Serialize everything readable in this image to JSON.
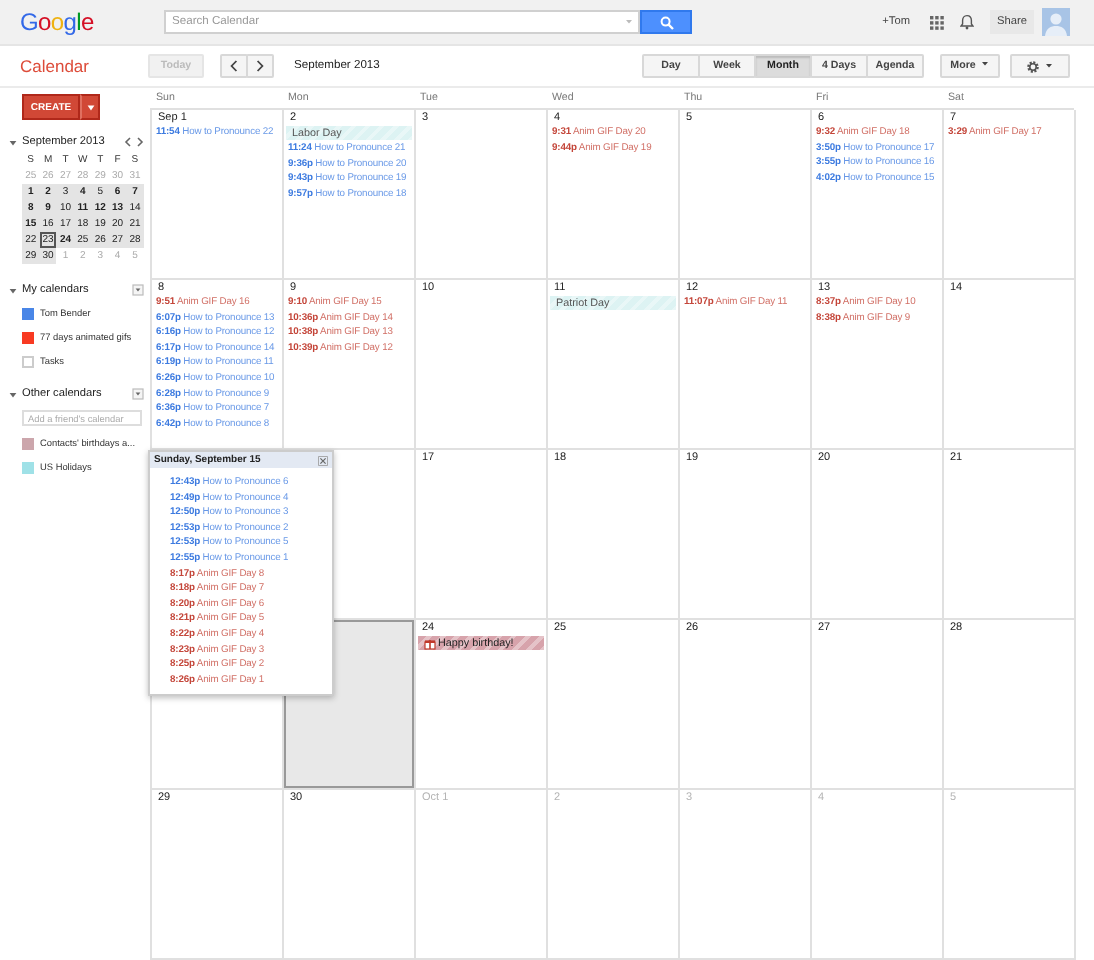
{
  "header": {
    "logo": "Google",
    "search": {
      "placeholder": "Search Calendar"
    },
    "user": "+Tom",
    "share": "Share"
  },
  "toolbar": {
    "app_title": "Calendar",
    "today": {
      "label": "Today",
      "disabled": true
    },
    "period": "September 2013",
    "views": [
      {
        "label": "Day",
        "selected": false
      },
      {
        "label": "Week",
        "selected": false
      },
      {
        "label": "Month",
        "selected": true
      },
      {
        "label": "4 Days",
        "selected": false
      },
      {
        "label": "Agenda",
        "selected": false
      }
    ],
    "more": "More"
  },
  "sidebar": {
    "create": "CREATE",
    "mini_calendar": {
      "title": "September 2013",
      "expanded": true,
      "weekdays": [
        "S",
        "M",
        "T",
        "W",
        "T",
        "F",
        "S"
      ],
      "weeks": [
        [
          {
            "day": "25",
            "in_month": false,
            "bold": false,
            "today": false
          },
          {
            "day": "26",
            "in_month": false,
            "bold": false,
            "today": false
          },
          {
            "day": "27",
            "in_month": false,
            "bold": false,
            "today": false
          },
          {
            "day": "28",
            "in_month": false,
            "bold": false,
            "today": false
          },
          {
            "day": "29",
            "in_month": false,
            "bold": false,
            "today": false
          },
          {
            "day": "30",
            "in_month": false,
            "bold": false,
            "today": false
          },
          {
            "day": "31",
            "in_month": false,
            "bold": false,
            "today": false
          }
        ],
        [
          {
            "day": "1",
            "in_month": true,
            "bold": true,
            "today": false
          },
          {
            "day": "2",
            "in_month": true,
            "bold": true,
            "today": false
          },
          {
            "day": "3",
            "in_month": true,
            "bold": false,
            "today": false
          },
          {
            "day": "4",
            "in_month": true,
            "bold": true,
            "today": false
          },
          {
            "day": "5",
            "in_month": true,
            "bold": false,
            "today": false
          },
          {
            "day": "6",
            "in_month": true,
            "bold": true,
            "today": false
          },
          {
            "day": "7",
            "in_month": true,
            "bold": true,
            "today": false
          }
        ],
        [
          {
            "day": "8",
            "in_month": true,
            "bold": true,
            "today": false
          },
          {
            "day": "9",
            "in_month": true,
            "bold": true,
            "today": false
          },
          {
            "day": "10",
            "in_month": true,
            "bold": false,
            "today": false
          },
          {
            "day": "11",
            "in_month": true,
            "bold": true,
            "today": false
          },
          {
            "day": "12",
            "in_month": true,
            "bold": true,
            "today": false
          },
          {
            "day": "13",
            "in_month": true,
            "bold": true,
            "today": false
          },
          {
            "day": "14",
            "in_month": true,
            "bold": false,
            "today": false
          }
        ],
        [
          {
            "day": "15",
            "in_month": true,
            "bold": true,
            "today": false
          },
          {
            "day": "16",
            "in_month": true,
            "bold": false,
            "today": false
          },
          {
            "day": "17",
            "in_month": true,
            "bold": false,
            "today": false
          },
          {
            "day": "18",
            "in_month": true,
            "bold": false,
            "today": false
          },
          {
            "day": "19",
            "in_month": true,
            "bold": false,
            "today": false
          },
          {
            "day": "20",
            "in_month": true,
            "bold": false,
            "today": false
          },
          {
            "day": "21",
            "in_month": true,
            "bold": false,
            "today": false
          }
        ],
        [
          {
            "day": "22",
            "in_month": true,
            "bold": false,
            "today": false
          },
          {
            "day": "23",
            "in_month": true,
            "bold": false,
            "today": true
          },
          {
            "day": "24",
            "in_month": true,
            "bold": true,
            "today": false
          },
          {
            "day": "25",
            "in_month": true,
            "bold": false,
            "today": false
          },
          {
            "day": "26",
            "in_month": true,
            "bold": false,
            "today": false
          },
          {
            "day": "27",
            "in_month": true,
            "bold": false,
            "today": false
          },
          {
            "day": "28",
            "in_month": true,
            "bold": false,
            "today": false
          }
        ],
        [
          {
            "day": "29",
            "in_month": true,
            "bold": false,
            "today": false
          },
          {
            "day": "30",
            "in_month": true,
            "bold": false,
            "today": false
          },
          {
            "day": "1",
            "in_month": false,
            "bold": false,
            "today": false
          },
          {
            "day": "2",
            "in_month": false,
            "bold": false,
            "today": false
          },
          {
            "day": "3",
            "in_month": false,
            "bold": false,
            "today": false
          },
          {
            "day": "4",
            "in_month": false,
            "bold": false,
            "today": false
          },
          {
            "day": "5",
            "in_month": false,
            "bold": false,
            "today": false
          }
        ]
      ]
    },
    "my_calendars": {
      "title": "My calendars",
      "expanded": true,
      "items": [
        {
          "name": "Tom Bender",
          "checked": true,
          "color": "#4986e7"
        },
        {
          "name": "77 days animated gifs",
          "checked": true,
          "color": "#f83a22"
        },
        {
          "name": "Tasks",
          "checked": false
        }
      ]
    },
    "other_calendars": {
      "title": "Other calendars",
      "expanded": true,
      "add_placeholder": "Add a friend's calendar",
      "items": [
        {
          "name": "Contacts' birthdays a...",
          "checked": true,
          "color": "#cca6ac"
        },
        {
          "name": "US Holidays",
          "checked": true,
          "color": "#9fe1e7"
        }
      ]
    }
  },
  "month": {
    "weekdays": [
      "Sun",
      "Mon",
      "Tue",
      "Wed",
      "Thu",
      "Fri",
      "Sat"
    ],
    "weeks": [
      {
        "days": [
          {
            "label": "Sep 1",
            "in_month": true,
            "today": false,
            "events": [
              {
                "kind": "timed",
                "time": "11:54",
                "title": "How to Pronounce 22",
                "color": "#3d7be0"
              }
            ]
          },
          {
            "label": "2",
            "in_month": true,
            "today": false,
            "events": [
              {
                "kind": "holiday",
                "title": "Labor Day",
                "color": "#ddf3f3"
              },
              {
                "kind": "timed",
                "time": "11:24",
                "title": "How to Pronounce 21",
                "color": "#3d7be0"
              },
              {
                "kind": "timed",
                "time": "9:36p",
                "title": "How to Pronounce 20",
                "color": "#3d7be0"
              },
              {
                "kind": "timed",
                "time": "9:43p",
                "title": "How to Pronounce 19",
                "color": "#3d7be0"
              },
              {
                "kind": "timed",
                "time": "9:57p",
                "title": "How to Pronounce 18",
                "color": "#3d7be0"
              }
            ]
          },
          {
            "label": "3",
            "in_month": true,
            "today": false
          },
          {
            "label": "4",
            "in_month": true,
            "today": false,
            "events": [
              {
                "kind": "timed",
                "time": "9:31",
                "title": "Anim GIF Day 20",
                "color": "#c4463a"
              },
              {
                "kind": "timed",
                "time": "9:44p",
                "title": "Anim GIF Day 19",
                "color": "#c4463a"
              }
            ]
          },
          {
            "label": "5",
            "in_month": true,
            "today": false
          },
          {
            "label": "6",
            "in_month": true,
            "today": false,
            "events": [
              {
                "kind": "timed",
                "time": "9:32",
                "title": "Anim GIF Day 18",
                "color": "#c4463a"
              },
              {
                "kind": "timed",
                "time": "3:50p",
                "title": "How to Pronounce 17",
                "color": "#3d7be0"
              },
              {
                "kind": "timed",
                "time": "3:55p",
                "title": "How to Pronounce 16",
                "color": "#3d7be0"
              },
              {
                "kind": "timed",
                "time": "4:02p",
                "title": "How to Pronounce 15",
                "color": "#3d7be0"
              }
            ]
          },
          {
            "label": "7",
            "in_month": true,
            "today": false,
            "events": [
              {
                "kind": "timed",
                "time": "3:29",
                "title": "Anim GIF Day 17",
                "color": "#c4463a"
              }
            ]
          }
        ]
      },
      {
        "days": [
          {
            "label": "8",
            "in_month": true,
            "today": false,
            "events": [
              {
                "kind": "timed",
                "time": "9:51",
                "title": "Anim GIF Day 16",
                "color": "#c4463a"
              },
              {
                "kind": "timed",
                "time": "6:07p",
                "title": "How to Pronounce 13",
                "color": "#3d7be0"
              },
              {
                "kind": "timed",
                "time": "6:16p",
                "title": "How to Pronounce 12",
                "color": "#3d7be0"
              },
              {
                "kind": "timed",
                "time": "6:17p",
                "title": "How to Pronounce 14",
                "color": "#3d7be0"
              },
              {
                "kind": "timed",
                "time": "6:19p",
                "title": "How to Pronounce 11",
                "color": "#3d7be0"
              },
              {
                "kind": "timed",
                "time": "6:26p",
                "title": "How to Pronounce 10",
                "color": "#3d7be0"
              },
              {
                "kind": "timed",
                "time": "6:28p",
                "title": "How to Pronounce 9",
                "color": "#3d7be0"
              },
              {
                "kind": "timed",
                "time": "6:36p",
                "title": "How to Pronounce 7",
                "color": "#3d7be0"
              },
              {
                "kind": "timed",
                "time": "6:42p",
                "title": "How to Pronounce 8",
                "color": "#3d7be0"
              }
            ]
          },
          {
            "label": "9",
            "in_month": true,
            "today": false,
            "events": [
              {
                "kind": "timed",
                "time": "9:10",
                "title": "Anim GIF Day 15",
                "color": "#c4463a"
              },
              {
                "kind": "timed",
                "time": "10:36p",
                "title": "Anim GIF Day 14",
                "color": "#c4463a"
              },
              {
                "kind": "timed",
                "time": "10:38p",
                "title": "Anim GIF Day 13",
                "color": "#c4463a"
              },
              {
                "kind": "timed",
                "time": "10:39p",
                "title": "Anim GIF Day 12",
                "color": "#c4463a"
              }
            ]
          },
          {
            "label": "10",
            "in_month": true,
            "today": false
          },
          {
            "label": "11",
            "in_month": true,
            "today": false,
            "events": [
              {
                "kind": "holiday",
                "title": "Patriot Day",
                "color": "#ddf3f3"
              }
            ]
          },
          {
            "label": "12",
            "in_month": true,
            "today": false,
            "events": [
              {
                "kind": "timed",
                "time": "11:07p",
                "title": "Anim GIF Day 11",
                "color": "#c4463a"
              }
            ]
          },
          {
            "label": "13",
            "in_month": true,
            "today": false,
            "events": [
              {
                "kind": "timed",
                "time": "8:37p",
                "title": "Anim GIF Day 10",
                "color": "#c4463a"
              },
              {
                "kind": "timed",
                "time": "8:38p",
                "title": "Anim GIF Day 9",
                "color": "#c4463a"
              }
            ]
          },
          {
            "label": "14",
            "in_month": true,
            "today": false
          }
        ]
      },
      {
        "days": [
          {
            "popup": {
              "title": "Sunday, September 15",
              "events": [
                {
                  "kind": "timed",
                  "time": "12:43p",
                  "title": "How to Pronounce 6",
                  "color": "#3d7be0"
                },
                {
                  "kind": "timed",
                  "time": "12:49p",
                  "title": "How to Pronounce 4",
                  "color": "#3d7be0"
                },
                {
                  "kind": "timed",
                  "time": "12:50p",
                  "title": "How to Pronounce 3",
                  "color": "#3d7be0"
                },
                {
                  "kind": "timed",
                  "time": "12:53p",
                  "title": "How to Pronounce 2",
                  "color": "#3d7be0"
                },
                {
                  "kind": "timed",
                  "time": "12:53p",
                  "title": "How to Pronounce 5",
                  "color": "#3d7be0"
                },
                {
                  "kind": "timed",
                  "time": "12:55p",
                  "title": "How to Pronounce 1",
                  "color": "#3d7be0"
                },
                {
                  "kind": "timed",
                  "time": "8:17p",
                  "title": "Anim GIF Day 8",
                  "color": "#c4463a"
                },
                {
                  "kind": "timed",
                  "time": "8:18p",
                  "title": "Anim GIF Day 7",
                  "color": "#c4463a"
                },
                {
                  "kind": "timed",
                  "time": "8:20p",
                  "title": "Anim GIF Day 6",
                  "color": "#c4463a"
                },
                {
                  "kind": "timed",
                  "time": "8:21p",
                  "title": "Anim GIF Day 5",
                  "color": "#c4463a"
                },
                {
                  "kind": "timed",
                  "time": "8:22p",
                  "title": "Anim GIF Day 4",
                  "color": "#c4463a"
                },
                {
                  "kind": "timed",
                  "time": "8:23p",
                  "title": "Anim GIF Day 3",
                  "color": "#c4463a"
                },
                {
                  "kind": "timed",
                  "time": "8:25p",
                  "title": "Anim GIF Day 2",
                  "color": "#c4463a"
                },
                {
                  "kind": "timed",
                  "time": "8:26p",
                  "title": "Anim GIF Day 1",
                  "color": "#c4463a"
                }
              ]
            }
          },
          {
            "today": false
          },
          {
            "label": "17",
            "in_month": true,
            "today": false
          },
          {
            "label": "18",
            "in_month": true,
            "today": false
          },
          {
            "label": "19",
            "in_month": true,
            "today": false
          },
          {
            "label": "20",
            "in_month": true,
            "today": false
          },
          {
            "label": "21",
            "in_month": true,
            "today": false
          }
        ]
      },
      {
        "days": [
          {
            "today": false
          },
          {
            "today": true
          },
          {
            "label": "24",
            "in_month": true,
            "today": false,
            "events": [
              {
                "kind": "birthday",
                "title": "Happy birthday!",
                "color": "#d7a3ab"
              }
            ]
          },
          {
            "label": "25",
            "in_month": true,
            "today": false
          },
          {
            "label": "26",
            "in_month": true,
            "today": false
          },
          {
            "label": "27",
            "in_month": true,
            "today": false
          },
          {
            "label": "28",
            "in_month": true,
            "today": false
          }
        ]
      },
      {
        "days": [
          {
            "label": "29",
            "in_month": true,
            "today": false
          },
          {
            "label": "30",
            "in_month": true,
            "today": false
          },
          {
            "label": "Oct 1",
            "in_month": false,
            "today": false
          },
          {
            "label": "2",
            "in_month": false,
            "today": false
          },
          {
            "label": "3",
            "in_month": false,
            "today": false
          },
          {
            "label": "4",
            "in_month": false,
            "today": false
          },
          {
            "label": "5",
            "in_month": false,
            "today": false
          }
        ]
      }
    ]
  }
}
